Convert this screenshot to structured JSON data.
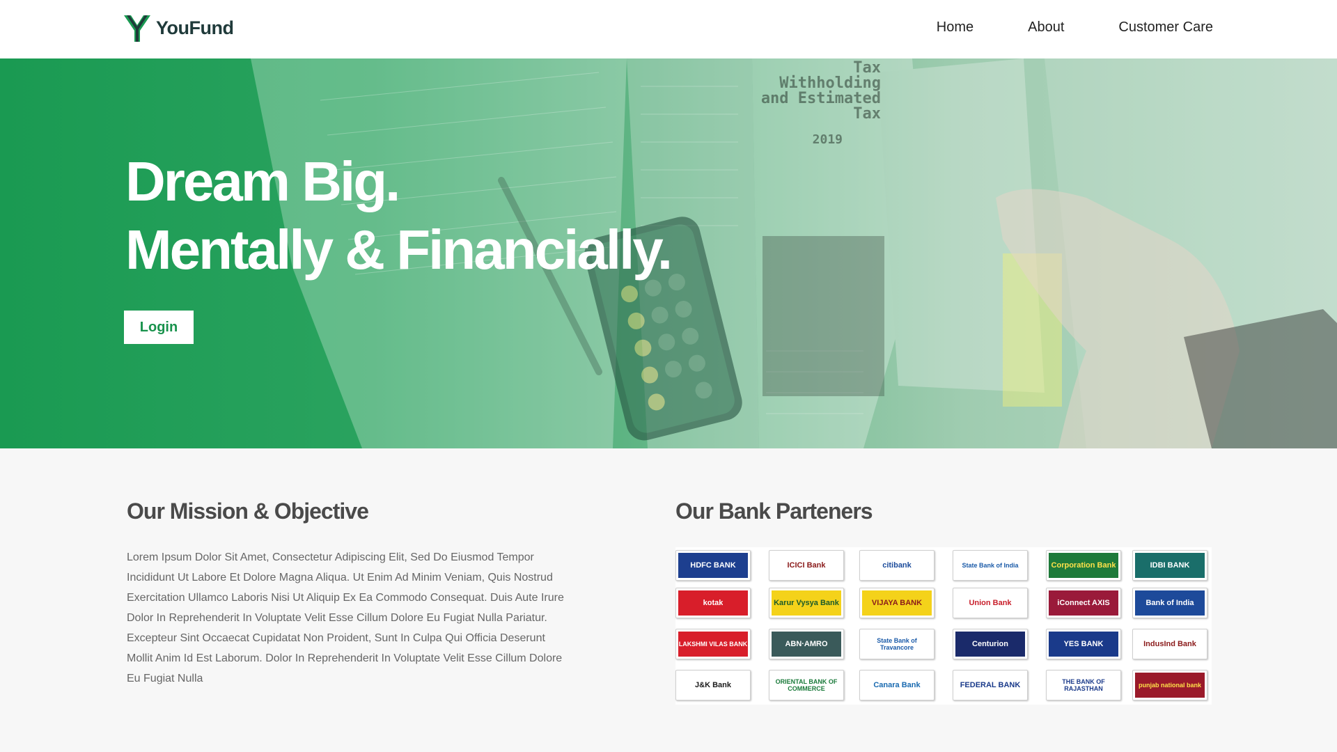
{
  "header": {
    "brand": "YouFund",
    "nav": [
      "Home",
      "About",
      "Customer Care"
    ]
  },
  "hero": {
    "title_line1": "Dream Big.",
    "title_line2": "Mentally & Financially.",
    "login_label": "Login",
    "bg_text": {
      "tax1": "Tax",
      "tax2": "Withholding",
      "tax3": "and Estimated",
      "tax4": "Tax",
      "year": "2019"
    }
  },
  "mission": {
    "title": "Our Mission & Objective",
    "text": "Lorem Ipsum Dolor Sit Amet, Consectetur Adipiscing Elit, Sed Do Eiusmod Tempor Incididunt Ut Labore Et Dolore Magna Aliqua. Ut Enim Ad Minim Veniam, Quis Nostrud Exercitation Ullamco Laboris Nisi Ut Aliquip Ex Ea Commodo Consequat. Duis Aute Irure Dolor In Reprehenderit In Voluptate Velit Esse Cillum Dolore Eu Fugiat Nulla Pariatur. Excepteur Sint Occaecat Cupidatat Non Proident, Sunt In Culpa Qui Officia Deserunt Mollit Anim Id Est Laborum. Dolor In Reprehenderit In Voluptate Velit Esse Cillum Dolore Eu Fugiat Nulla"
  },
  "partners": {
    "title": "Our Bank Parteners",
    "banks": [
      {
        "label": "HDFC BANK",
        "bg": "#1d3f8f",
        "fg": "#ffffff"
      },
      {
        "label": "ICICI Bank",
        "bg": "#ffffff",
        "fg": "#8a1a1a"
      },
      {
        "label": "citibank",
        "bg": "#ffffff",
        "fg": "#1a4a9a"
      },
      {
        "label": "State Bank of India",
        "bg": "#ffffff",
        "fg": "#1a5aa8"
      },
      {
        "label": "Corporation Bank",
        "bg": "#1e7a3a",
        "fg": "#ffe14a"
      },
      {
        "label": "IDBI BANK",
        "bg": "#1a6e6a",
        "fg": "#ffffff"
      },
      {
        "label": "kotak",
        "bg": "#d81e2a",
        "fg": "#ffffff"
      },
      {
        "label": "Karur Vysya Bank",
        "bg": "#f4d21a",
        "fg": "#1a5a2a"
      },
      {
        "label": "VIJAYA BANK",
        "bg": "#f4d21a",
        "fg": "#8a1a1a"
      },
      {
        "label": "Union Bank",
        "bg": "#ffffff",
        "fg": "#c81e2a"
      },
      {
        "label": "iConnect AXIS",
        "bg": "#9a1a3a",
        "fg": "#ffffff"
      },
      {
        "label": "Bank of India",
        "bg": "#1d4a9a",
        "fg": "#ffffff"
      },
      {
        "label": "LAKSHMI VILAS BANK",
        "bg": "#d81e2a",
        "fg": "#ffffff"
      },
      {
        "label": "ABN·AMRO",
        "bg": "#3a5a5a",
        "fg": "#ffffff"
      },
      {
        "label": "State Bank of Travancore",
        "bg": "#ffffff",
        "fg": "#1a5aa8"
      },
      {
        "label": "Centurion",
        "bg": "#1a2a6a",
        "fg": "#ffffff"
      },
      {
        "label": "YES BANK",
        "bg": "#1a3a8a",
        "fg": "#ffffff"
      },
      {
        "label": "IndusInd Bank",
        "bg": "#ffffff",
        "fg": "#8a1a1a"
      },
      {
        "label": "J&K Bank",
        "bg": "#ffffff",
        "fg": "#1a1a1a"
      },
      {
        "label": "ORIENTAL BANK OF COMMERCE",
        "bg": "#ffffff",
        "fg": "#1a7a3a"
      },
      {
        "label": "Canara Bank",
        "bg": "#ffffff",
        "fg": "#1a6ab0"
      },
      {
        "label": "FEDERAL BANK",
        "bg": "#ffffff",
        "fg": "#1a3a8a"
      },
      {
        "label": "THE BANK OF RAJASTHAN",
        "bg": "#ffffff",
        "fg": "#1a3a8a"
      },
      {
        "label": "punjab national bank",
        "bg": "#9a1a2a",
        "fg": "#ffe14a"
      }
    ]
  },
  "colors": {
    "brand_green": "#18924c",
    "logo_dark": "#1f3a3a"
  }
}
